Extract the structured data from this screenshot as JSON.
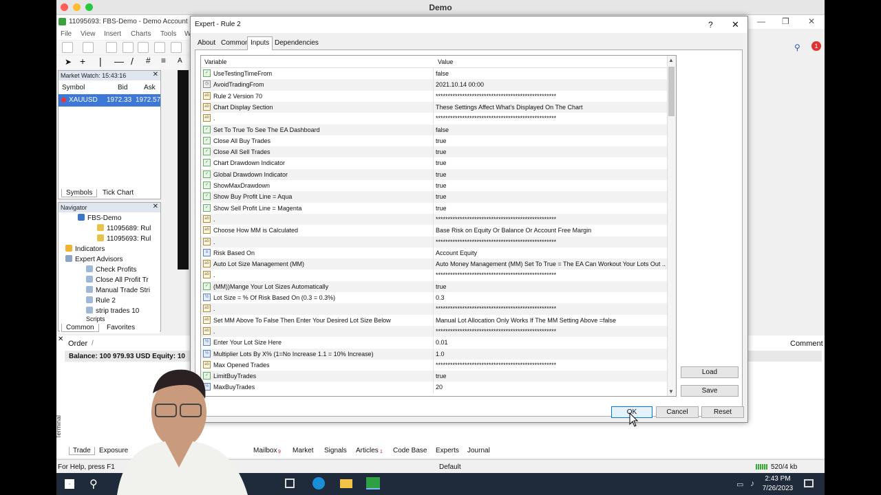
{
  "mac": {
    "title": "Demo"
  },
  "app": {
    "title": "11095693: FBS-Demo - Demo Account - ",
    "menu": [
      "File",
      "View",
      "Insert",
      "Charts",
      "Tools",
      "W"
    ]
  },
  "market_watch": {
    "header": "Market Watch: 15:43:16",
    "columns": [
      "Symbol",
      "Bid",
      "Ask"
    ],
    "rows": [
      {
        "symbol": "XAUUSD",
        "bid": "1972.33",
        "ask": "1972.57"
      }
    ],
    "tabs": [
      "Symbols",
      "Tick Chart"
    ]
  },
  "navigator": {
    "header": "Navigator",
    "items": [
      "FBS-Demo",
      "11095689: Rul",
      "11095693: Rul",
      "Indicators",
      "Expert Advisors",
      "Check Profits",
      "Close All Profit Tr",
      "Manual Trade Stri",
      "Rule 2",
      "strip trades 10",
      "Scripts"
    ],
    "tabs": [
      "Common",
      "Favorites"
    ]
  },
  "terminal": {
    "order_col": "Order",
    "order_sort": "/",
    "comment_col": "Comment",
    "balance": "Balance: 100 979.93 USD  Equity: 10",
    "side_label": "Terminal",
    "tabs": [
      "Trade",
      "Exposure",
      "Mailbox",
      "Market",
      "Signals",
      "Articles",
      "Code Base",
      "Experts",
      "Journal"
    ],
    "mailbox_badge": "9",
    "articles_badge": "1"
  },
  "status": {
    "help": "For Help, press F1",
    "profile": "Default",
    "conn": "520/4 kb"
  },
  "taskbar": {
    "time": "2:43 PM",
    "date": "7/26/2023"
  },
  "notif_badge": "1",
  "dialog": {
    "title": "Expert - Rule 2",
    "help": "?",
    "close": "✕",
    "tabs": [
      "About",
      "Common",
      "Inputs",
      "Dependencies"
    ],
    "active_tab": "Inputs",
    "col_variable": "Variable",
    "col_value": "Value",
    "rows": [
      {
        "type": "bool",
        "name": "UseTestingTimeFrom",
        "value": "false"
      },
      {
        "type": "datetime",
        "name": "AvoidTradingFrom",
        "value": "2021.10.14 00:00"
      },
      {
        "type": "str",
        "name": "Rule 2 Version 70",
        "value": "**************************************************"
      },
      {
        "type": "str",
        "name": "Chart Display Section",
        "value": "These Settings Affect What's Displayed On The Chart"
      },
      {
        "type": "str",
        "name": ".",
        "value": "**************************************************"
      },
      {
        "type": "bool",
        "name": "Set To True To See The EA Dashboard",
        "value": "false"
      },
      {
        "type": "bool",
        "name": "Close All Buy Trades",
        "value": "true"
      },
      {
        "type": "bool",
        "name": "Close All Sell Trades",
        "value": "true"
      },
      {
        "type": "bool",
        "name": "Chart Drawdown Indicator",
        "value": "true"
      },
      {
        "type": "bool",
        "name": "Global Drawdown Indicator",
        "value": "true"
      },
      {
        "type": "bool",
        "name": "ShowMaxDrawdown",
        "value": "true"
      },
      {
        "type": "bool",
        "name": "Show Buy Profit Line = Aqua",
        "value": "true"
      },
      {
        "type": "bool",
        "name": "Show Sell Profit Line = Magenta",
        "value": "true"
      },
      {
        "type": "str",
        "name": ".",
        "value": "**************************************************"
      },
      {
        "type": "str",
        "name": "Choose How MM is Calculated",
        "value": "Base Risk on Equity Or Balance Or Account Free Margin"
      },
      {
        "type": "str",
        "name": ".",
        "value": "**************************************************"
      },
      {
        "type": "enum",
        "name": "Risk Based On",
        "value": "Account Equity"
      },
      {
        "type": "str",
        "name": "Auto Lot Size Management (MM)",
        "value": "Auto Money Management (MM) Set To True = The EA Can Workout Your Lots Out ..."
      },
      {
        "type": "str",
        "name": ".",
        "value": "**************************************************"
      },
      {
        "type": "bool",
        "name": "(MM))Mange Your Lot Sizes Automatically",
        "value": "true"
      },
      {
        "type": "num",
        "name": "Lot Size = % Of Risk Based On (0.3 = 0.3%)",
        "value": "0.3"
      },
      {
        "type": "str",
        "name": ".",
        "value": "**************************************************"
      },
      {
        "type": "str",
        "name": "Set MM Above To False Then Enter Your Desired Lot Size Below",
        "value": "Manual Lot Allocation Only Works If The MM Setting Above =false"
      },
      {
        "type": "str",
        "name": ".",
        "value": "**************************************************"
      },
      {
        "type": "num",
        "name": "Enter Your Lot Size Here",
        "value": "0.01"
      },
      {
        "type": "num",
        "name": "Multiplier Lots By X% (1=No Increase 1.1 = 10% Increase)",
        "value": "1.0"
      },
      {
        "type": "str",
        "name": "Max Opened Trades",
        "value": "**************************************************"
      },
      {
        "type": "bool",
        "name": "LimitBuyTrades",
        "value": "true"
      },
      {
        "type": "num",
        "name": "MaxBuyTrades",
        "value": "20"
      }
    ],
    "buttons": {
      "load": "Load",
      "save": "Save",
      "ok": "OK",
      "cancel": "Cancel",
      "reset": "Reset"
    }
  }
}
